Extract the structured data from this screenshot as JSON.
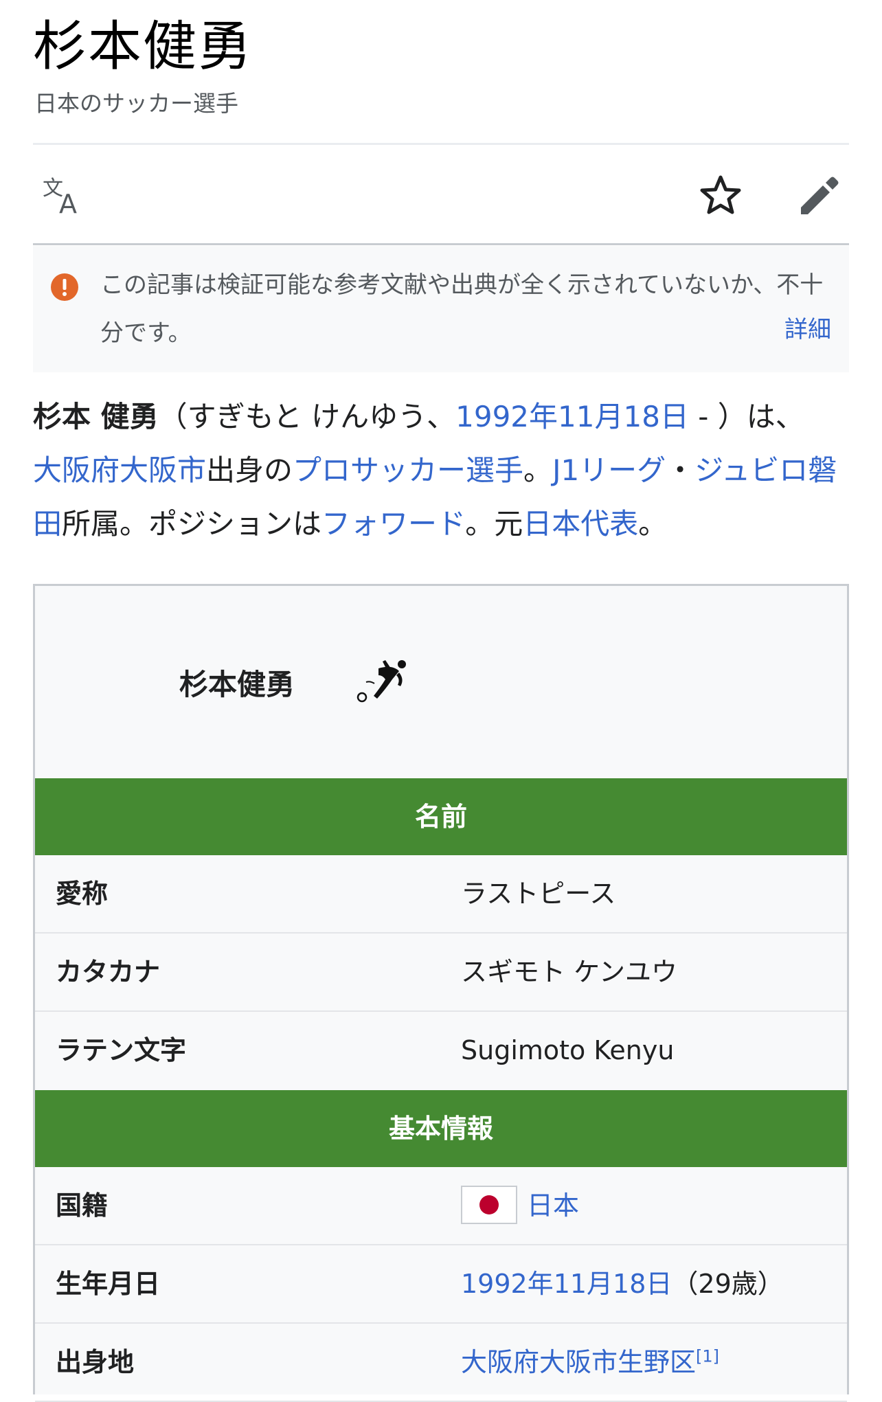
{
  "page": {
    "title": "杉本健勇",
    "subtitle": "日本のサッカー選手"
  },
  "toolbar": {
    "language_icon": "translate-icon",
    "watch_icon": "star-icon",
    "edit_icon": "pencil-icon"
  },
  "notice": {
    "text": "この記事は検証可能な参考文献や出典が全く示されていないか、不十分です。",
    "more_label": "詳細",
    "icon": "exclamation-circle-icon",
    "icon_color": "#dd3333"
  },
  "lead": {
    "name_bold": "杉本 健勇",
    "reading": "（すぎもと けんゆう、",
    "birth_link": "1992年11月18日",
    "after_birth": " - ）は、",
    "birthplace_link": "大阪府大阪市",
    "t1": "出身の",
    "profession_link": "プロサッカー選手",
    "t2": "。",
    "league_link": "J1リーグ",
    "t3": "・",
    "club_link": "ジュビロ磐田",
    "t4": "所属。ポジションは",
    "position_link": "フォワード",
    "t5": "。元",
    "national_link": "日本代表",
    "t6": "。"
  },
  "infobox": {
    "name": "杉本健勇",
    "icon": "soccer-player-icon",
    "header_color": "#458a32",
    "section_name": "名前",
    "rows_name": [
      {
        "label": "愛称",
        "value": "ラストピース"
      },
      {
        "label": "カタカナ",
        "value": "スギモト ケンユウ"
      },
      {
        "label": "ラテン文字",
        "value": "Sugimoto Kenyu"
      }
    ],
    "section_basic": "基本情報",
    "nationality_label": "国籍",
    "nationality_value": "日本",
    "birthdate_label": "生年月日",
    "birthdate_value": "1992年11月18日",
    "age_value": "（29歳）",
    "birthplace_label": "出身地",
    "birthplace_value": "大阪府大阪市生野区",
    "birthplace_ref": "[1]"
  }
}
